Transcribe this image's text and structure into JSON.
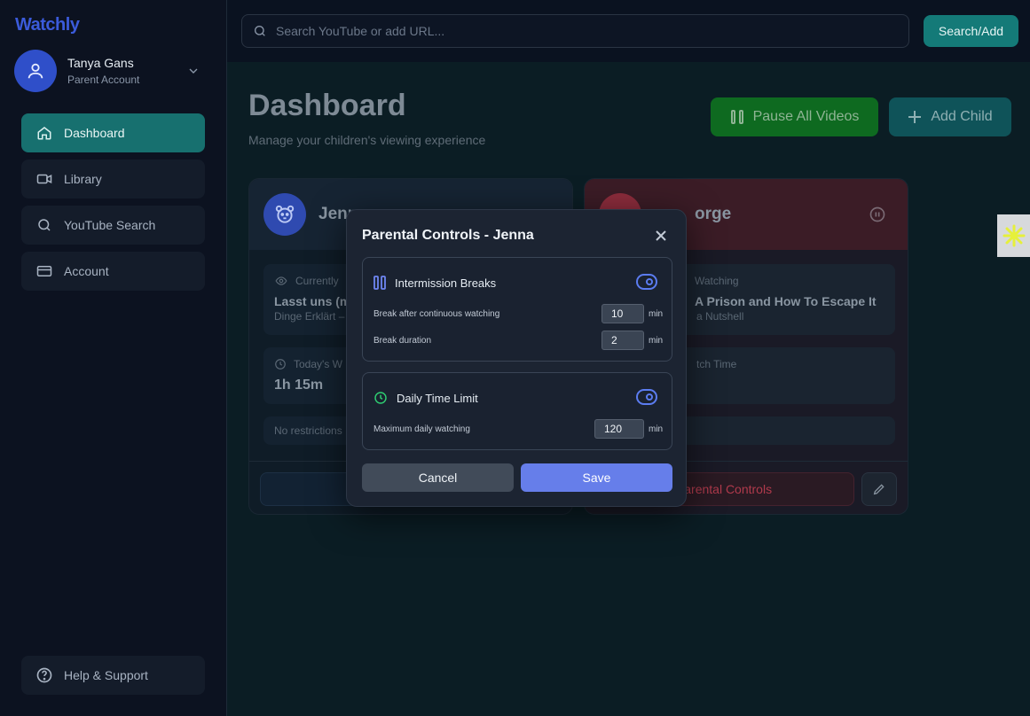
{
  "app": {
    "brand": "Watchly"
  },
  "user": {
    "name": "Tanya Gans",
    "role": "Parent Account"
  },
  "sidebar": {
    "items": [
      {
        "label": "Dashboard",
        "icon": "home-icon",
        "active": true
      },
      {
        "label": "Library",
        "icon": "video-icon",
        "active": false
      },
      {
        "label": "YouTube Search",
        "icon": "search-icon",
        "active": false
      },
      {
        "label": "Account",
        "icon": "credit-card-icon",
        "active": false
      }
    ],
    "help": "Help & Support"
  },
  "topbar": {
    "search_placeholder": "Search YouTube or add URL...",
    "search_button": "Search/Add"
  },
  "main": {
    "title": "Dashboard",
    "subtitle": "Manage your children's viewing experience",
    "pause_all": "Pause All Videos",
    "add_child": "Add Child"
  },
  "children": [
    {
      "name": "Jenna",
      "visible_name": "Jenn",
      "currently_label": "Currently",
      "video_title": "Lasst uns (m",
      "video_channel": "Dinge Erklärt –",
      "today_label": "Today's W",
      "today_value": "1h 15m",
      "restrictions": "No restrictions"
    },
    {
      "name": "George",
      "visible_name": "orge",
      "currently_label": "Watching",
      "video_title": "A Prison and How To Escape It",
      "video_channel": "a Nutshell",
      "today_label": "tch Time",
      "parental_controls": "Parental Controls"
    }
  ],
  "modal": {
    "title": "Parental Controls - Jenna",
    "intermission": {
      "title": "Intermission Breaks",
      "enabled": true,
      "break_after_label": "Break after continuous watching",
      "break_after_value": "10",
      "break_duration_label": "Break duration",
      "break_duration_value": "2",
      "unit": "min"
    },
    "daily_limit": {
      "title": "Daily Time Limit",
      "enabled": true,
      "max_label": "Maximum daily watching",
      "max_value": "120",
      "unit": "min"
    },
    "cancel": "Cancel",
    "save": "Save"
  },
  "colors": {
    "accent": "#667eea",
    "teal": "#147a78",
    "green": "#0e6a20",
    "danger": "#b03a4c"
  }
}
